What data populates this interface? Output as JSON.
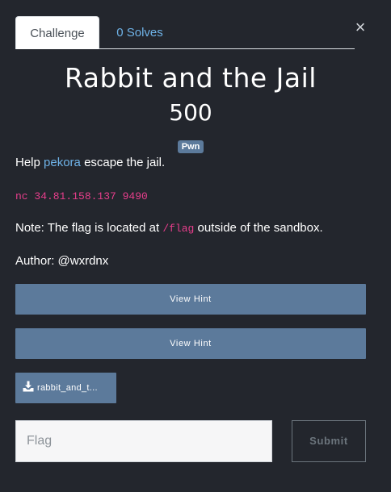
{
  "tabs": {
    "challenge_label": "Challenge",
    "solves_label": "0 Solves"
  },
  "close_glyph": "×",
  "challenge": {
    "title": "Rabbit and the Jail",
    "points": "500",
    "category": "Pwn",
    "description": {
      "help_prefix": "Help ",
      "help_link": "pekora",
      "help_suffix": " escape the jail.",
      "command": "nc 34.81.158.137 9490",
      "note_prefix": "Note: The flag is located at ",
      "note_code": "/flag",
      "note_suffix": " outside of the sandbox.",
      "author": "Author: @wxrdnx"
    }
  },
  "hints": [
    {
      "label": "View Hint"
    },
    {
      "label": "View Hint"
    }
  ],
  "file": {
    "label": "rabbit_and_t...",
    "icon": "download-icon"
  },
  "flag_input": {
    "value": "",
    "placeholder": "Flag"
  },
  "submit_label": "Submit",
  "colors": {
    "background": "#23262d",
    "link": "#6fb3e8",
    "code": "#e83e8c",
    "button": "#5c7a9b"
  }
}
